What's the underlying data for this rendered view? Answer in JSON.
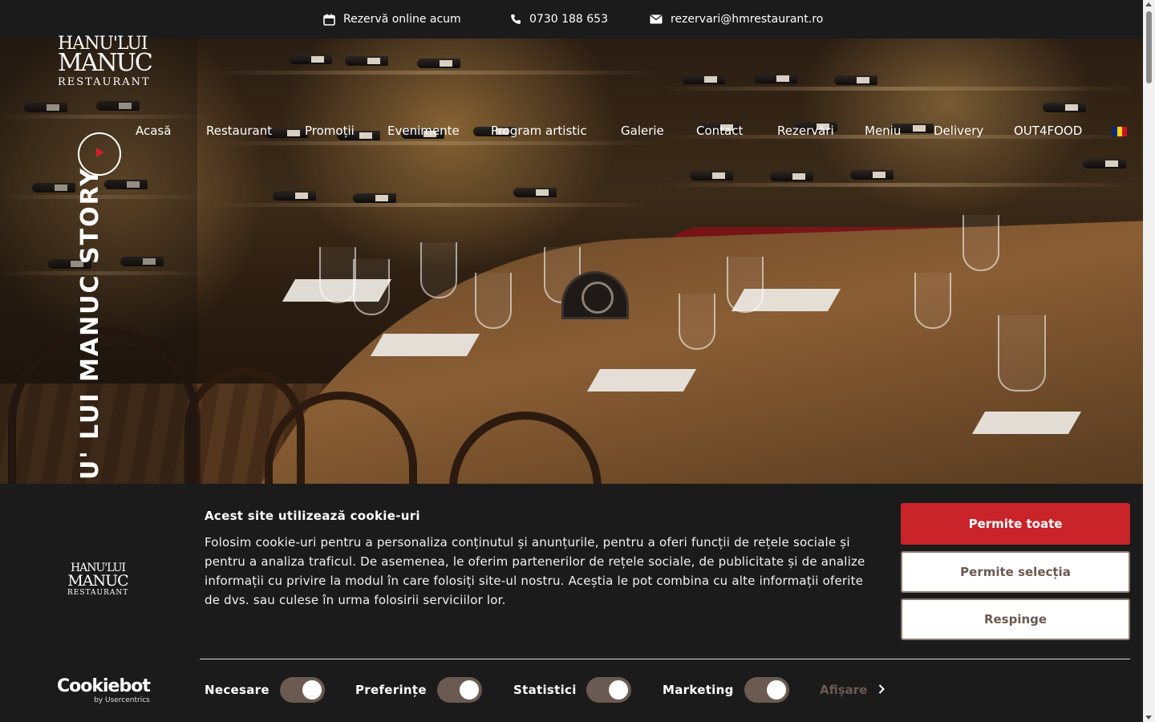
{
  "topbar": {
    "reserve_label": "Rezervă online acum",
    "phone": "0730 188 653",
    "email": "rezervari@hmrestaurant.ro",
    "icons": [
      "calendar-icon",
      "phone-icon",
      "mail-icon"
    ]
  },
  "logo": {
    "line1": "HANU'LUI",
    "line2": "MANUC",
    "line3": "RESTAURANT"
  },
  "nav": {
    "items": [
      "Acasă",
      "Restaurant",
      "Promoții",
      "Evenimente",
      "Program artistic",
      "Galerie",
      "Contact",
      "Rezervări",
      "Meniu",
      "Delivery",
      "OUT4FOOD"
    ],
    "language_flag": "romania-flag"
  },
  "hero": {
    "story_label": "U' LUI MANUC STORY",
    "play_icon": "play-icon"
  },
  "cookie": {
    "title": "Acest site utilizează cookie-uri",
    "text": "Folosim cookie-uri pentru a personaliza conținutul și anunțurile, pentru a oferi funcții de rețele sociale și pentru a analiza traficul. De asemenea, le oferim partenerilor de rețele sociale, de publicitate și de analize informații cu privire la modul în care folosiți site-ul nostru. Aceștia le pot combina cu alte informații oferite de dvs. sau culese în urma folosirii serviciilor lor.",
    "buttons": {
      "allow_all": "Permite toate",
      "allow_selection": "Permite selecția",
      "deny": "Respinge"
    },
    "toggles": [
      {
        "label": "Necesare",
        "on": true
      },
      {
        "label": "Preferințe",
        "on": true
      },
      {
        "label": "Statistici",
        "on": true
      },
      {
        "label": "Marketing",
        "on": true
      }
    ],
    "details_label": "Afișare",
    "provider": {
      "name": "Cookiebot",
      "by": "by Usercentrics"
    }
  },
  "colors": {
    "brand_red": "#c8242a",
    "toggle_on": "#6b5a52",
    "background": "#1b1b1b"
  }
}
